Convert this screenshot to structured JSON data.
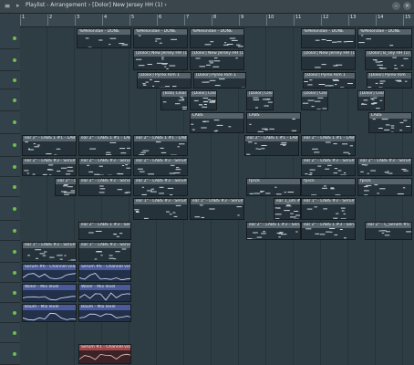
{
  "titlebar": {
    "title": "Playlist - Arrangement › [Dolor] New Jersey HH (1) ›",
    "menu_icon": "hamburger-icon",
    "close_label": "×",
    "min_label": "–"
  },
  "ruler": {
    "bars": [
      "1",
      "2",
      "3",
      "4",
      "5",
      "6",
      "7",
      "8",
      "9",
      "10",
      "11",
      "12",
      "13",
      "14",
      "15"
    ]
  },
  "clips": {
    "melodae_1": "%Melondae - DONE",
    "melodae_2": "%Melondae - DONE",
    "melodae_3": "%Melondae - DONE",
    "melodae_4": "%Melondae - DONE",
    "melodae_5": "%Melondae - DONE",
    "nj_1": "[Dolor] New Jersey HH (1)",
    "nj_2": "[Dolor] New Jersey HH (1)",
    "nj_3": "[Dolor] New Jersey HH (1)",
    "nj_4": "[Dolor] B_sey HH (1)",
    "pyrex_1": "[Dolor] Pyrex Rim 1",
    "pyrex_2": "[Dolor] Pyrex Rim 1",
    "pyrex_3": "[Dolor] Pyrex Rim 1",
    "pyrex_4": "[Dolor] Pyrex Rim",
    "clap_1": "[Bdo] Clear",
    "clap_2": "[Dolor] Clear",
    "clap_3": "[Dolor] Clear",
    "clap_4": "[Dolor] Clear",
    "clap_5": "[Dolor] Clear",
    "labs_1": "LABS",
    "labs_2": "LABS",
    "labs_3": "LABS",
    "ear_a1": "ear 2\" - LABS 1 #1 - LABS 1 #",
    "ear_a2": "ear 2\" - LABS 1 #1 - LABS 1 #",
    "ear_a3": "ear 2\" - LABS 1 #1 - LABS 1 #",
    "ear_a4": "ear 2\" - LABS 1 #1 - LABS 1 #",
    "ear_a5": "ear 2\" - LABS 1 #1 - LABS 1 #",
    "serum_b1": "ear 2\" - LABS #3 - Serum",
    "serum_b2": "ear 2\" - LABS #3 - Serum",
    "serum_b3": "ear 2\" - LABS #3 - Serum",
    "serum_b4": "ear 2\" - LABS #3 - Serum",
    "serum_b5": "ear 2\" - LABS #3 - Serum",
    "serum_c1": "ear 2\" - LABS #3 - Serum #2",
    "serum_c2": "ear 2\" - LABS #3 - Serum #2",
    "serum_c3": "ear 2\" - LABS #3 - Serum #2",
    "serum_c4": "ear 2\" - LABS #3 - Serum #2",
    "fpsck_1": "fpsck",
    "fpsck_2": "fpsck",
    "fpsck_3": "fpsck",
    "fpsck_4": "fpsck",
    "serum_d1": "ear 1\" - LABS #3 - Serum #4",
    "serum_d2": "ear 1\" - LABS #3 - Serum #4",
    "serum_d3": "ear 1_um #4",
    "serum_d4": "ear 1\" - LABS #3 - Serum #4",
    "serum_e1": "ear 2\" - LABS 1 #3 - Serum #5",
    "serum_e2": "ear 2\" - LABS 1 #3 - Serum #5",
    "serum_e3": "ear 2\" - LABS 1 #3 - Serum #5",
    "serum_e4": "ear 2\" - L_Serum #5",
    "serum_f1": "ear 1\" - LABS #3 - Serum #1",
    "serum_f2": "ear 1\" - LABS #3 - Serum #1",
    "chvol_1": "Serum #6 - Channel volume",
    "chvol_2": "Serum #6 - Channel volume",
    "mix_1": "Wöler - Mix level",
    "mix_2": "Wöler - Mix level",
    "mix_3": "Baum - Mix level",
    "mix_4": "Baum - Mix level",
    "chvol_3": "Serum #1 - Channel volume"
  },
  "colors": {
    "background": "#2a3940",
    "pattern_header": "#56636b",
    "automation_header": "#4a5a9a",
    "accent_red": "#a04848",
    "track_led": "#6cc04a"
  }
}
